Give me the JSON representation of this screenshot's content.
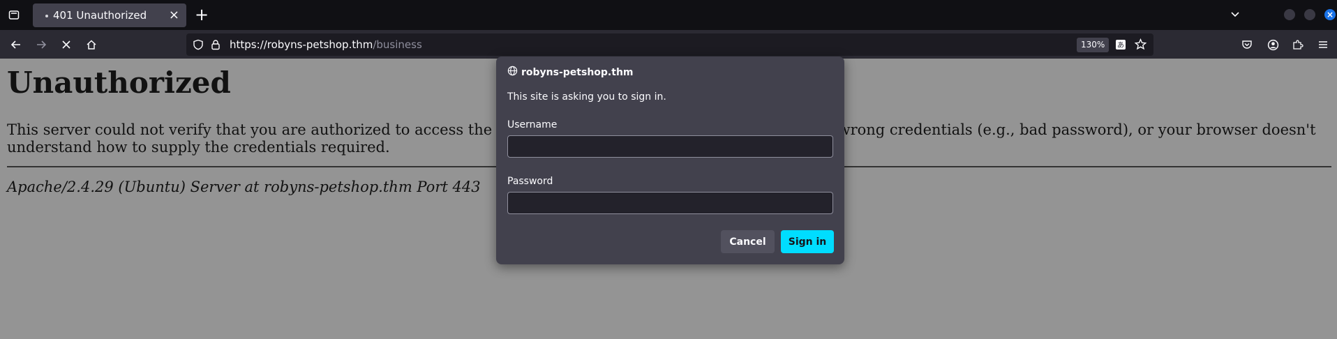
{
  "browser": {
    "tab": {
      "title": "401 Unauthorized"
    },
    "url": {
      "host": "https://robyns-petshop.thm",
      "path": "/business"
    },
    "zoom": "130%",
    "icons": {
      "tab_list": "tab-list-icon",
      "new_tab": "plus-icon",
      "tab_overflow": "chevron-down-icon",
      "back": "back-arrow-icon",
      "forward": "forward-arrow-icon",
      "stop": "stop-icon",
      "home": "home-icon",
      "shield": "shield-icon",
      "lock": "lock-icon",
      "translate": "translate-icon",
      "bookmark": "star-icon",
      "pocket": "pocket-icon",
      "account": "account-icon",
      "extensions": "puzzle-icon",
      "menu": "hamburger-menu-icon"
    },
    "colors": {
      "tabstrip": "#101014",
      "toolbar": "#2b2a33",
      "accent": "#00ddff"
    }
  },
  "page": {
    "heading": "Unauthorized",
    "message": "This server could not verify that you are authorized to access the document requested. Either you supplied the wrong credentials (e.g., bad password), or your browser doesn't understand how to supply the credentials required.",
    "signature": "Apache/2.4.29 (Ubuntu) Server at robyns-petshop.thm Port 443"
  },
  "dialog": {
    "origin": "robyns-petshop.thm",
    "prompt": "This site is asking you to sign in.",
    "username_label": "Username",
    "username_value": "",
    "password_label": "Password",
    "password_value": "",
    "cancel_label": "Cancel",
    "signin_label": "Sign in"
  }
}
